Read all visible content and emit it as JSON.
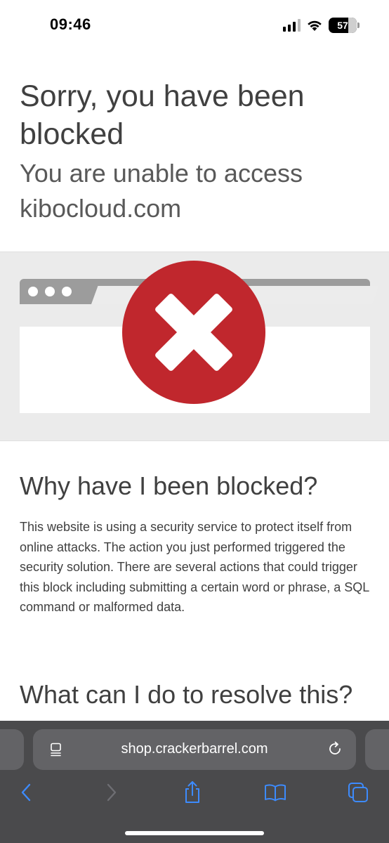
{
  "status_bar": {
    "time": "09:46",
    "battery": "57",
    "icons": [
      "cellular-signal-icon",
      "wifi-icon",
      "battery-icon"
    ]
  },
  "page": {
    "title": "Sorry, you have been blocked",
    "subtitle": "You are unable to access kibocloud.com",
    "illustration": {
      "icons": [
        "browser-window-icon",
        "error-x-icon"
      ],
      "error_color": "#c0272d"
    },
    "why_heading": "Why have I been blocked?",
    "why_body": "This website is using a security service to protect itself from online attacks. The action you just performed triggered the security solution. There are several actions that could trigger this block including submitting a certain word or phrase, a SQL command or malformed data.",
    "resolve_heading": "What can I do to resolve this?"
  },
  "browser": {
    "url": "shop.crackerbarrel.com",
    "toolbar_icons": [
      "page-menu-icon",
      "reload-icon",
      "back-icon",
      "forward-icon",
      "share-icon",
      "bookmarks-icon",
      "tabs-icon"
    ],
    "accent_color": "#3d8bfd"
  }
}
